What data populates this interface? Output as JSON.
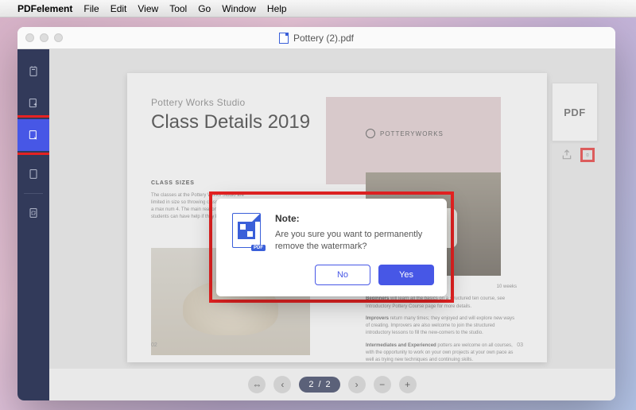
{
  "menubar": {
    "appname": "PDFelement",
    "items": [
      "File",
      "Edit",
      "View",
      "Tool",
      "Go",
      "Window",
      "Help"
    ]
  },
  "window": {
    "title": "Pottery (2).pdf"
  },
  "sidebar": {
    "items": [
      {
        "name": "thumbnails-icon"
      },
      {
        "name": "export-icon"
      },
      {
        "name": "watermark-tool-icon",
        "active": true,
        "highlighted": true
      },
      {
        "name": "blank-page-icon"
      },
      {
        "name": "crop-icon"
      }
    ]
  },
  "document": {
    "subtitle": "Pottery Works Studio",
    "title": "Class Details 2019",
    "brand": "POTTERYWORKS",
    "section_heading": "CLASS SIZES",
    "left_text": "The classes at the Pottery Works Studio are limited in size so throwing classes and slots with a max num 4. The main reason for this is so that students can have help if they later quickly.",
    "right_duration": "10 weeks",
    "right_p1_bold": "Beginners",
    "right_p1": " will learn all the basics on a structured ten course, see Introductory Pottery Course page for more details.",
    "right_p2_bold": "Improvers",
    "right_p2": " return many times; they enjoyed and will explore new ways of creating. Improvers are also welcome to join the structured introductory lessons to fill the new-comers to the studio.",
    "right_p3_bold": "Intermediates and Experienced",
    "right_p3": " potters are welcome on all courses, with the opportunity to work on your own projects at your own pace as well as trying new techniques and continuing skills.",
    "page_left": "02",
    "page_right": "03"
  },
  "thumbnail_panel": {
    "label": "PDF",
    "tools": {
      "share_icon": "share-icon",
      "delete_icon": "trash-icon",
      "delete_highlighted": true
    }
  },
  "footer": {
    "current_page": "2",
    "total_pages": "2",
    "separator": "/"
  },
  "dialog": {
    "title": "Note:",
    "message": "Are you sure you want to permanently remove the watermark?",
    "no_label": "No",
    "yes_label": "Yes",
    "icon_badge": "PDF"
  }
}
